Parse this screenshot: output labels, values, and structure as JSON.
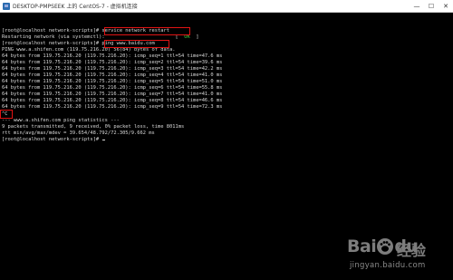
{
  "window": {
    "title": "DESKTOP-PMPSEEK 上的 CentOS-7 - 虚拟机连接",
    "minimize_icon": "minimize-icon",
    "maximize_icon": "maximize-icon",
    "close_icon": "close-icon"
  },
  "terminal": {
    "lines": [
      {
        "text": "[root@localhost network-scripts]# service network restart"
      },
      {
        "text": "Restarting network (via systemctl):                        [  ",
        "ok": "OK",
        "tail": "  ]"
      },
      {
        "text": "[root@localhost network-scripts]# ping www.baidu.com"
      },
      {
        "text": "PING www.a.shifen.com (119.75.216.20) 56(84) bytes of data."
      },
      {
        "text": "64 bytes from 119.75.216.20 (119.75.216.20): icmp_seq=1 ttl=54 time=47.6 ms"
      },
      {
        "text": "64 bytes from 119.75.216.20 (119.75.216.20): icmp_seq=2 ttl=54 time=39.6 ms"
      },
      {
        "text": "64 bytes from 119.75.216.20 (119.75.216.20): icmp_seq=3 ttl=54 time=42.2 ms"
      },
      {
        "text": "64 bytes from 119.75.216.20 (119.75.216.20): icmp_seq=4 ttl=54 time=41.0 ms"
      },
      {
        "text": "64 bytes from 119.75.216.20 (119.75.216.20): icmp_seq=5 ttl=54 time=51.0 ms"
      },
      {
        "text": "64 bytes from 119.75.216.20 (119.75.216.20): icmp_seq=6 ttl=54 time=55.8 ms"
      },
      {
        "text": "64 bytes from 119.75.216.20 (119.75.216.20): icmp_seq=7 ttl=54 time=41.0 ms"
      },
      {
        "text": "64 bytes from 119.75.216.20 (119.75.216.20): icmp_seq=8 ttl=54 time=46.6 ms"
      },
      {
        "text": "64 bytes from 119.75.216.20 (119.75.216.20): icmp_seq=9 ttl=54 time=72.3 ms"
      },
      {
        "text": "^C"
      },
      {
        "text": "--- www.a.shifen.com ping statistics ---"
      },
      {
        "text": "9 packets transmitted, 9 received, 0% packet loss, time 8011ms"
      },
      {
        "text": "rtt min/avg/max/mdev = 39.654/48.792/72.305/9.662 ms"
      },
      {
        "text": "[root@localhost network-scripts]# "
      }
    ]
  },
  "watermark": {
    "brand_a": "Bai",
    "brand_b": "du",
    "brand_cn": "经验",
    "url": "jingyan.baidu.com"
  },
  "colors": {
    "background": "#000000",
    "text": "#d8d8d8",
    "ok": "#3fd13f",
    "highlight": "#e01414"
  }
}
